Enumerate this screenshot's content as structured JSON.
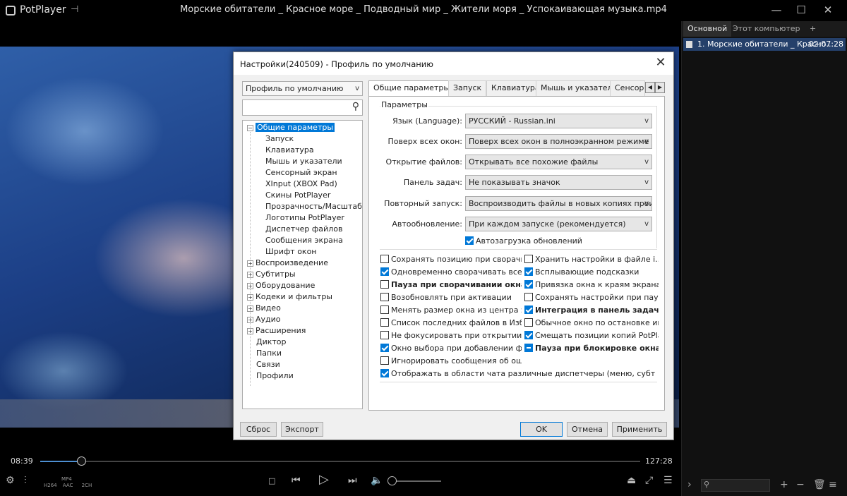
{
  "titlebar": {
    "app_name": "PotPlayer",
    "video_title": "Морские обитатели _ Красное море _ Подводный мир _ Жители моря _ Успокаивающая музыка.mp4",
    "buttons": [
      "minimize-icon",
      "maximize-icon",
      "close-icon"
    ]
  },
  "playback": {
    "time_current": "08:39",
    "time_total": "127:28",
    "progress": 0.068,
    "codec_badges": {
      "container": "MP4",
      "video": "H264",
      "audio": "AAC",
      "channels": "2CH"
    },
    "volume": 0.0
  },
  "playlist": {
    "tabs": {
      "main": "Основной",
      "pc": "Этот компьютер",
      "add": "+"
    },
    "items": [
      {
        "title": "1. Морские обитатели _ Красно...",
        "duration": "02:07:28"
      }
    ]
  },
  "dialog": {
    "title": "Настройки(240509) - Профиль по умолчанию",
    "profile": "Профиль по умолчанию",
    "tree": [
      {
        "label": "Общие параметры",
        "selected": true
      },
      {
        "label": "Запуск"
      },
      {
        "label": "Клавиатура"
      },
      {
        "label": "Мышь и указатели"
      },
      {
        "label": "Сенсорный экран"
      },
      {
        "label": "XInput (XBOX Pad)"
      },
      {
        "label": "Скины PotPlayer"
      },
      {
        "label": "Прозрачность/Масштаб"
      },
      {
        "label": "Логотипы PotPlayer"
      },
      {
        "label": "Диспетчер файлов"
      },
      {
        "label": "Сообщения экрана"
      },
      {
        "label": "Шрифт окон"
      },
      {
        "label": "Воспроизведение"
      },
      {
        "label": "Субтитры"
      },
      {
        "label": "Оборудование"
      },
      {
        "label": "Кодеки и фильтры"
      },
      {
        "label": "Видео"
      },
      {
        "label": "Аудио"
      },
      {
        "label": "Расширения"
      },
      {
        "label": "Диктор"
      },
      {
        "label": "Папки"
      },
      {
        "label": "Связи"
      },
      {
        "label": "Профили"
      }
    ],
    "tabs": [
      "Общие параметры",
      "Запуск",
      "Клавиатура",
      "Мышь и указатели",
      "Сенсор"
    ],
    "group_title": "Параметры",
    "rows": [
      {
        "label": "Язык (Language):",
        "value": "РУССКИЙ - Russian.ini"
      },
      {
        "label": "Поверх всех окон:",
        "value": "Поверх всех окон в полноэкранном режиме"
      },
      {
        "label": "Открытие файлов:",
        "value": "Открывать все похожие файлы"
      },
      {
        "label": "Панель задач:",
        "value": "Не показывать значок"
      },
      {
        "label": "Повторный запуск:",
        "value": "Воспроизводить файлы в новых копиях проигр"
      },
      {
        "label": "Автообновление:",
        "value": "При каждом запуске (рекомендуется)"
      }
    ],
    "autoupdate_check": {
      "label": "Автозагрузка обновлений",
      "checked": true
    },
    "checks_left": [
      {
        "label": "Сохранять позицию при сворачив...",
        "checked": false,
        "bold": false
      },
      {
        "label": "Одновременно сворачивать все о...",
        "checked": true,
        "bold": false
      },
      {
        "label": "Пауза при сворачивании окна",
        "checked": false,
        "bold": true
      },
      {
        "label": "Возобновлять при активации",
        "checked": false,
        "bold": false
      },
      {
        "label": "Менять размер окна из центра экр...",
        "checked": false,
        "bold": false
      },
      {
        "label": "Список последних файлов в Избра...",
        "checked": false,
        "bold": false
      },
      {
        "label": "Не фокусировать при открытии фа...",
        "checked": false,
        "bold": false
      },
      {
        "label": "Окно выбора при добавлении фай...",
        "checked": true,
        "bold": false
      },
      {
        "label": "Игнорировать сообщения об оши...",
        "checked": false,
        "bold": false
      }
    ],
    "checks_right": [
      {
        "label": "Хранить настройки в файле i...",
        "state": "off",
        "bold": false
      },
      {
        "label": "Всплывающие подсказки",
        "state": "on",
        "bold": false
      },
      {
        "label": "Привязка окна к краям экрана",
        "state": "on",
        "bold": false
      },
      {
        "label": "Сохранять настройки при паузе",
        "state": "off",
        "bold": false
      },
      {
        "label": "Интеграция в панель задач",
        "state": "on",
        "bold": true
      },
      {
        "label": "Обычное окно по остановке иг...",
        "state": "off",
        "bold": false
      },
      {
        "label": "Смещать позиции копий PotPla...",
        "state": "on",
        "bold": false
      },
      {
        "label": "Пауза при блокировке окна",
        "state": "indeterminate",
        "bold": true
      }
    ],
    "check_wide": {
      "label": "Отображать в области чата различные диспетчеры (меню, субтитров и...",
      "checked": true
    },
    "buttons": {
      "reset": "Сброс",
      "export": "Экспорт",
      "ok": "OK",
      "cancel": "Отмена",
      "apply": "Применить"
    }
  },
  "colors": {
    "accent": "#0078d7",
    "seek": "#4d8fd1",
    "playlist_selected": "#25406a"
  }
}
